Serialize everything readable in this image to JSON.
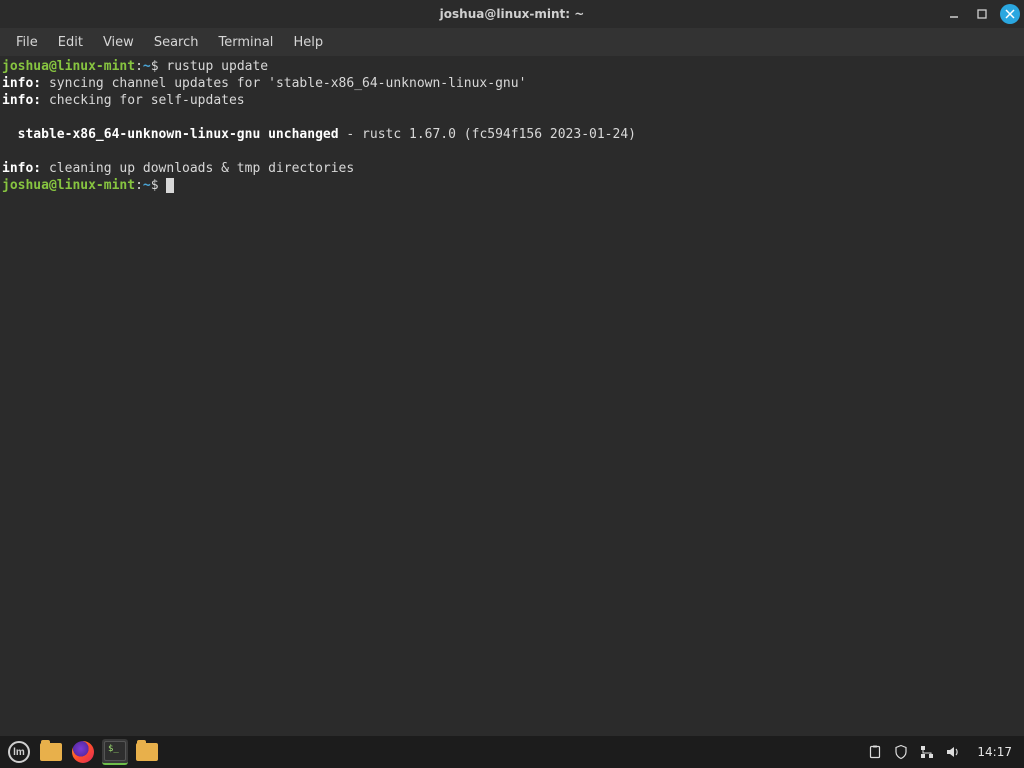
{
  "window": {
    "title": "joshua@linux-mint: ~"
  },
  "menubar": {
    "items": [
      "File",
      "Edit",
      "View",
      "Search",
      "Terminal",
      "Help"
    ]
  },
  "terminal": {
    "prompt_user_host": "joshua@linux-mint",
    "prompt_separator": ":",
    "prompt_path": "~",
    "prompt_symbol": "$",
    "command": "rustup update",
    "lines": {
      "info_label": "info:",
      "sync": " syncing channel updates for 'stable-x86_64-unknown-linux-gnu'",
      "check": " checking for self-updates",
      "stable_pre": "  ",
      "stable_bold": "stable-x86_64-unknown-linux-gnu unchanged",
      "stable_rest": " - rustc 1.67.0 (fc594f156 2023-01-24)",
      "cleanup": " cleaning up downloads & tmp directories"
    }
  },
  "taskbar": {
    "term_glyph": "$_",
    "clock": "14:17"
  }
}
